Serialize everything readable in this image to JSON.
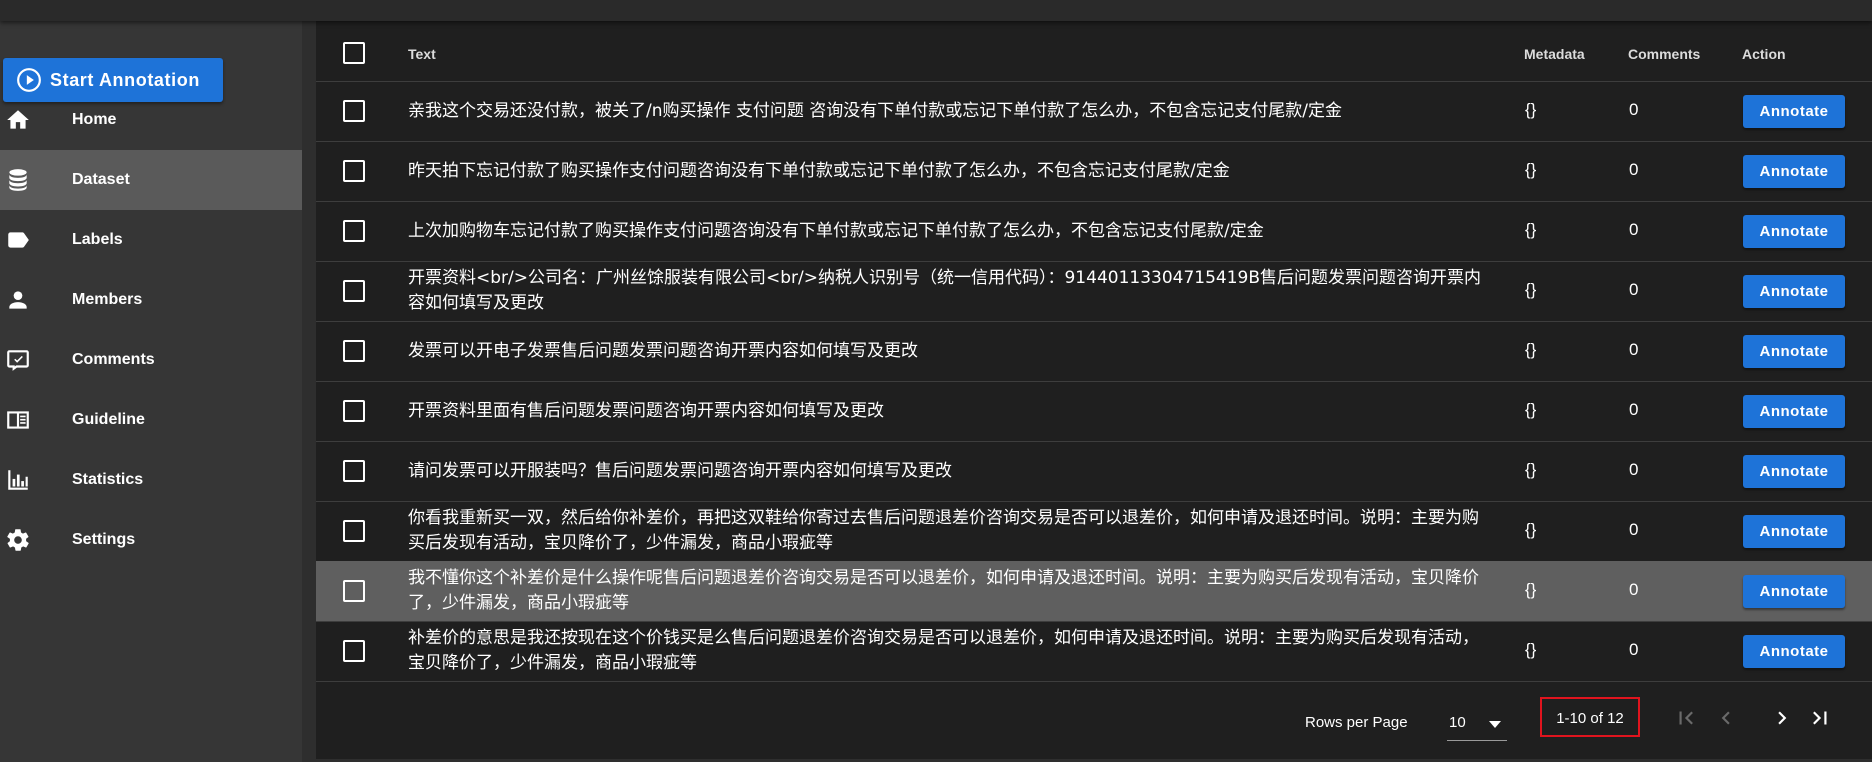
{
  "sidebar": {
    "start_button": "Start Annotation",
    "items": [
      {
        "label": "Home",
        "icon": "home-icon"
      },
      {
        "label": "Dataset",
        "icon": "database-icon",
        "active": true
      },
      {
        "label": "Labels",
        "icon": "label-icon"
      },
      {
        "label": "Members",
        "icon": "person-icon"
      },
      {
        "label": "Comments",
        "icon": "comment-icon"
      },
      {
        "label": "Guideline",
        "icon": "book-icon"
      },
      {
        "label": "Statistics",
        "icon": "bar-chart-icon"
      },
      {
        "label": "Settings",
        "icon": "gear-icon"
      }
    ]
  },
  "table": {
    "headers": {
      "text": "Text",
      "metadata": "Metadata",
      "comments": "Comments",
      "action": "Action"
    },
    "rows": [
      {
        "text": "亲我这个交易还没付款，被关了/n购买操作 支付问题 咨询没有下单付款或忘记下单付款了怎么办，不包含忘记支付尾款/定金",
        "metadata": "{}",
        "comments": "0",
        "action": "Annotate"
      },
      {
        "text": "昨天拍下忘记付款了购买操作支付问题咨询没有下单付款或忘记下单付款了怎么办，不包含忘记支付尾款/定金",
        "metadata": "{}",
        "comments": "0",
        "action": "Annotate"
      },
      {
        "text": "上次加购物车忘记付款了购买操作支付问题咨询没有下单付款或忘记下单付款了怎么办，不包含忘记支付尾款/定金",
        "metadata": "{}",
        "comments": "0",
        "action": "Annotate"
      },
      {
        "text": "开票资料<br/>公司名：广州丝馀服装有限公司<br/>纳税人识别号（统一信用代码）：91440113304715419B售后问题发票问题咨询开票内容如何填写及更改",
        "metadata": "{}",
        "comments": "0",
        "action": "Annotate"
      },
      {
        "text": "发票可以开电子发票售后问题发票问题咨询开票内容如何填写及更改",
        "metadata": "{}",
        "comments": "0",
        "action": "Annotate"
      },
      {
        "text": "开票资料里面有售后问题发票问题咨询开票内容如何填写及更改",
        "metadata": "{}",
        "comments": "0",
        "action": "Annotate"
      },
      {
        "text": "请问发票可以开服装吗？售后问题发票问题咨询开票内容如何填写及更改",
        "metadata": "{}",
        "comments": "0",
        "action": "Annotate"
      },
      {
        "text": "你看我重新买一双，然后给你补差价，再把这双鞋给你寄过去售后问题退差价咨询交易是否可以退差价，如何申请及退还时间。说明：主要为购买后发现有活动，宝贝降价了，少件漏发，商品小瑕疵等",
        "metadata": "{}",
        "comments": "0",
        "action": "Annotate"
      },
      {
        "text": "我不懂你这个补差价是什么操作呢售后问题退差价咨询交易是否可以退差价，如何申请及退还时间。说明：主要为购买后发现有活动，宝贝降价了，少件漏发，商品小瑕疵等",
        "metadata": "{}",
        "comments": "0",
        "action": "Annotate",
        "highlighted": true
      },
      {
        "text": "补差价的意思是我还按现在这个价钱买是么售后问题退差价咨询交易是否可以退差价，如何申请及退还时间。说明：主要为购买后发现有活动，宝贝降价了，少件漏发，商品小瑕疵等",
        "metadata": "{}",
        "comments": "0",
        "action": "Annotate"
      }
    ]
  },
  "pagination": {
    "rows_per_page_label": "Rows per Page",
    "rows_per_page_value": "10",
    "range": "1-10 of 12"
  },
  "colors": {
    "accent": "#1e73d8",
    "highlight_box": "#e0141e",
    "sidebar_bg": "#363636",
    "active_item_bg": "#5a5a5a",
    "panel_bg": "#1f1f1f"
  }
}
